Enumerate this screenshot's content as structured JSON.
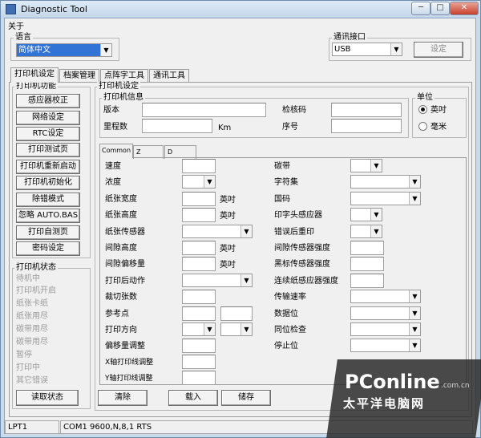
{
  "window": {
    "title": "Diagnostic Tool",
    "min_glyph": "─",
    "max_glyph": "□",
    "close_glyph": "✕"
  },
  "menubar": {
    "about": "关于"
  },
  "language": {
    "group": "语言",
    "selected": "简体中文"
  },
  "comm": {
    "group": "通讯接口",
    "selected": "USB",
    "set_button": "设定"
  },
  "tabs": [
    "打印机设定",
    "档案管理",
    "点阵字工具",
    "通讯工具"
  ],
  "functions": {
    "group": "打印机功能",
    "buttons": [
      "感应器校正",
      "网络设定",
      "RTC设定",
      "打印测试页",
      "打印机重新启动",
      "打印机初始化",
      "除错模式",
      "忽略 AUTO.BAS",
      "打印自测页",
      "密码设定"
    ]
  },
  "status": {
    "group": "打印机状态",
    "items": [
      "待机中",
      "打印机开启",
      "纸张卡纸",
      "纸张用尽",
      "碳带用尽",
      "碳带用尽",
      "暂停",
      "打印中",
      "其它错误"
    ],
    "read_button": "读取状态"
  },
  "settings": {
    "group": "打印机设定",
    "info": {
      "group": "打印机信息",
      "version": "版本",
      "checksum": "检核码",
      "mileage": "里程数",
      "mileage_unit": "Km",
      "serial": "序号"
    },
    "unit": {
      "group": "单位",
      "inch": "英吋",
      "mm": "毫米",
      "selected": "inch"
    }
  },
  "subtabs": [
    "Common",
    "Z",
    "D"
  ],
  "common": {
    "speed": "速度",
    "density": "浓度",
    "paper_width": "纸张宽度",
    "paper_height": "纸张高度",
    "paper_sensor": "纸张传感器",
    "gap_height": "间隙高度",
    "gap_offset": "间隙偏移量",
    "post_print": "打印后动作",
    "cut_count": "裁切张数",
    "reference": "参考点",
    "direction": "打印方向",
    "offset_adjust": "偏移量调整",
    "x_adjust": "X轴打印线调整",
    "y_adjust": "Y轴打印线调整",
    "unit_inch": "英吋",
    "ribbon": "碳带",
    "codepage": "字符集",
    "country": "国码",
    "head_sensor": "印字头感应器",
    "reprint": "错误后重印",
    "gap_sensor_intensity": "间隙传感器强度",
    "black_mark_intensity": "黑标传感器强度",
    "continuous_intensity": "连续纸感应器强度",
    "baud_rate": "传输速率",
    "data_bits": "数据位",
    "parity": "同位检查",
    "stop_bits": "停止位"
  },
  "actions": {
    "clear": "清除",
    "load": "载入",
    "save": "储存"
  },
  "statusbar": {
    "port": "LPT1",
    "com": "COM1 9600,N,8,1 RTS"
  },
  "watermark": {
    "brand": "PConline",
    "domain": ".com.cn",
    "cn": "太平洋电脑网"
  },
  "colors": {
    "titlebar": "#c9daea",
    "close": "#c8402c"
  }
}
